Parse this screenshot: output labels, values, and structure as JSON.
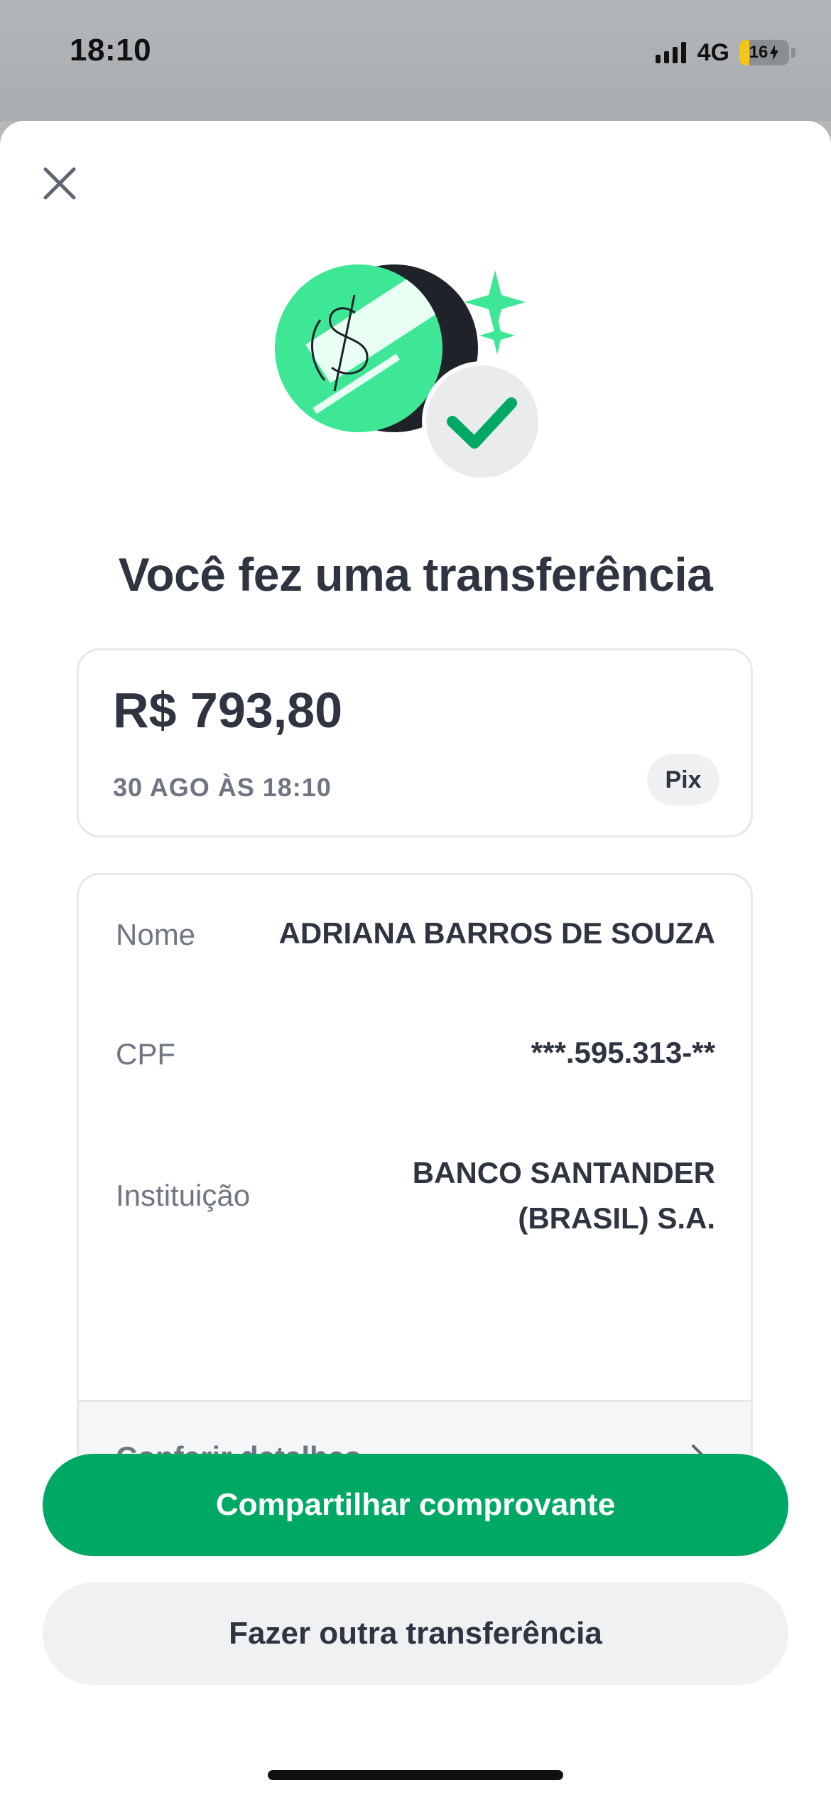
{
  "status_bar": {
    "time": "18:10",
    "network": "4G",
    "battery": "16"
  },
  "sheet": {
    "close_icon": "close-icon",
    "illustration": "money-transfer-success-illustration",
    "title": "Você fez uma transferência"
  },
  "summary": {
    "amount": "R$ 793,80",
    "datetime": "30 AGO ÀS 18:10",
    "method": "Pix"
  },
  "details": {
    "rows": [
      {
        "label": "Nome",
        "value": "ADRIANA BARROS DE SOUZA"
      },
      {
        "label": "CPF",
        "value": "***.595.313-**"
      },
      {
        "label": "Instituição",
        "value_line1": "BANCO SANTANDER",
        "value_line2": "(BRASIL) S.A."
      }
    ],
    "footer_label": "Conferir detalhes"
  },
  "actions": {
    "primary_label": "Compartilhar comprovante",
    "secondary_label": "Fazer outra transferência"
  },
  "colors": {
    "accent_green": "#00a865",
    "illustration_green": "#3ee796",
    "text_dark": "#2e3440",
    "text_muted": "#6f7681"
  }
}
